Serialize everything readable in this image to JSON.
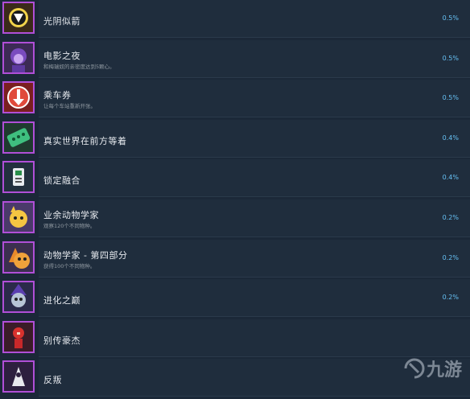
{
  "achievements": [
    {
      "name": "光阴似箭",
      "desc": "",
      "pct": "0.5%",
      "icon": "triangle-clock-icon"
    },
    {
      "name": "电影之夜",
      "desc": "和梅瑞奴的亲密度达到5颗心。",
      "pct": "0.5%",
      "icon": "purple-girl-portrait-icon"
    },
    {
      "name": "乘车券",
      "desc": "让每个车站重新开张。",
      "pct": "0.5%",
      "icon": "down-arrow-badge-icon"
    },
    {
      "name": "真实世界在前方等着",
      "desc": "",
      "pct": "0.4%",
      "icon": "ticket-icon"
    },
    {
      "name": "锁定融合",
      "desc": "",
      "pct": "0.4%",
      "icon": "device-icon"
    },
    {
      "name": "业余动物学家",
      "desc": "观察120个不同物种。",
      "pct": "0.2%",
      "icon": "yellow-creature-icon"
    },
    {
      "name": "动物学家 - 第四部分",
      "desc": "获得100个不同物种。",
      "pct": "0.2%",
      "icon": "orange-cat-icon"
    },
    {
      "name": "进化之巅",
      "desc": "",
      "pct": "0.2%",
      "icon": "wizard-creature-icon"
    },
    {
      "name": "别传豪杰",
      "desc": "",
      "pct": "",
      "icon": "red-hero-icon"
    },
    {
      "name": "反叛",
      "desc": "",
      "pct": "",
      "icon": "dark-figure-icon"
    }
  ],
  "watermark": "九游"
}
